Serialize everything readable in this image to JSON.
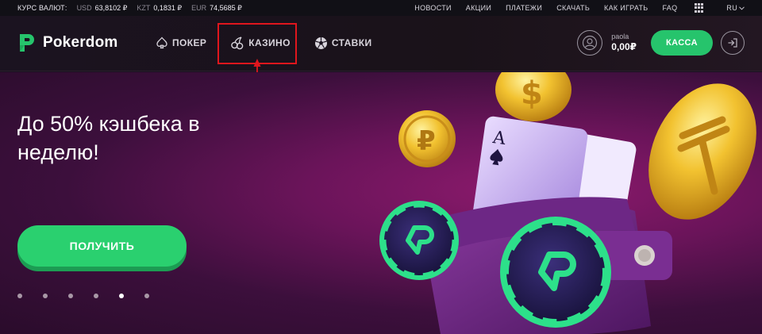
{
  "topbar": {
    "rates_label": "КУРС ВАЛЮТ:",
    "rates": [
      {
        "currency": "USD",
        "value": "63,8102 ₽"
      },
      {
        "currency": "KZT",
        "value": "0,1831 ₽"
      },
      {
        "currency": "EUR",
        "value": "74,5685 ₽"
      }
    ],
    "links": [
      "НОВОСТИ",
      "АКЦИИ",
      "ПЛАТЕЖИ",
      "СКАЧАТЬ",
      "КАК ИГРАТЬ",
      "FAQ"
    ],
    "lang": "RU"
  },
  "header": {
    "logo_text": "Pokerdom",
    "nav": [
      {
        "label": "ПОКЕР",
        "icon": "spade-icon"
      },
      {
        "label": "КАЗИНО",
        "icon": "cherries-icon"
      },
      {
        "label": "СТАВКИ",
        "icon": "soccer-ball-icon"
      }
    ],
    "user": {
      "name": "paola",
      "balance": "0,00₽"
    },
    "kassa_label": "КАССА"
  },
  "hero": {
    "title": "До 50% кэшбека в неделю!",
    "cta_label": "ПОЛУЧИТЬ",
    "slides_count": 6,
    "active_slide": 5
  },
  "colors": {
    "accent_green": "#26c46c",
    "highlight_red": "#e0161d",
    "hero_purple": "#6b145a"
  }
}
